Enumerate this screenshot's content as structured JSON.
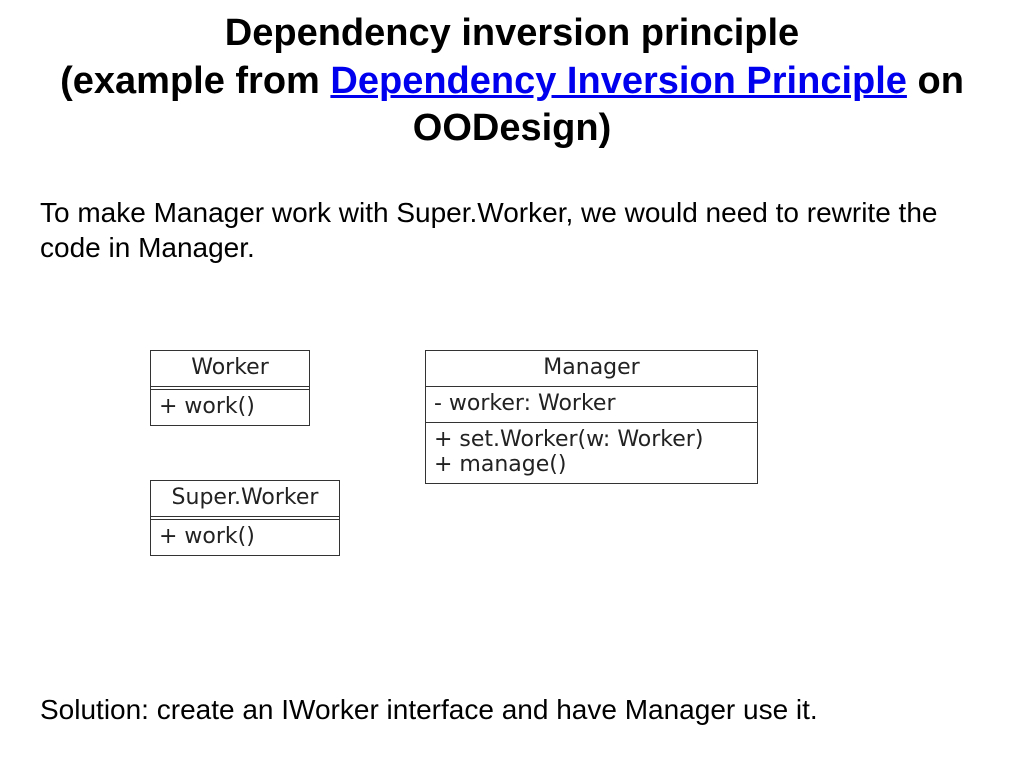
{
  "title": {
    "line1": "Dependency inversion principle",
    "prefix": "(example from ",
    "link": "Dependency Inversion Principle",
    "suffix": " on OODesign)"
  },
  "intro": "To make Manager work with Super.Worker, we would need to rewrite the code in Manager.",
  "solution": "Solution: create an IWorker interface and have Manager use it.",
  "uml": {
    "worker": {
      "name": "Worker",
      "method": "+ work()"
    },
    "superworker": {
      "name": "Super.Worker",
      "method": "+ work()"
    },
    "manager": {
      "name": "Manager",
      "attr": "- worker: Worker",
      "method1": "+ set.Worker(w: Worker)",
      "method2": "+ manage()"
    }
  }
}
